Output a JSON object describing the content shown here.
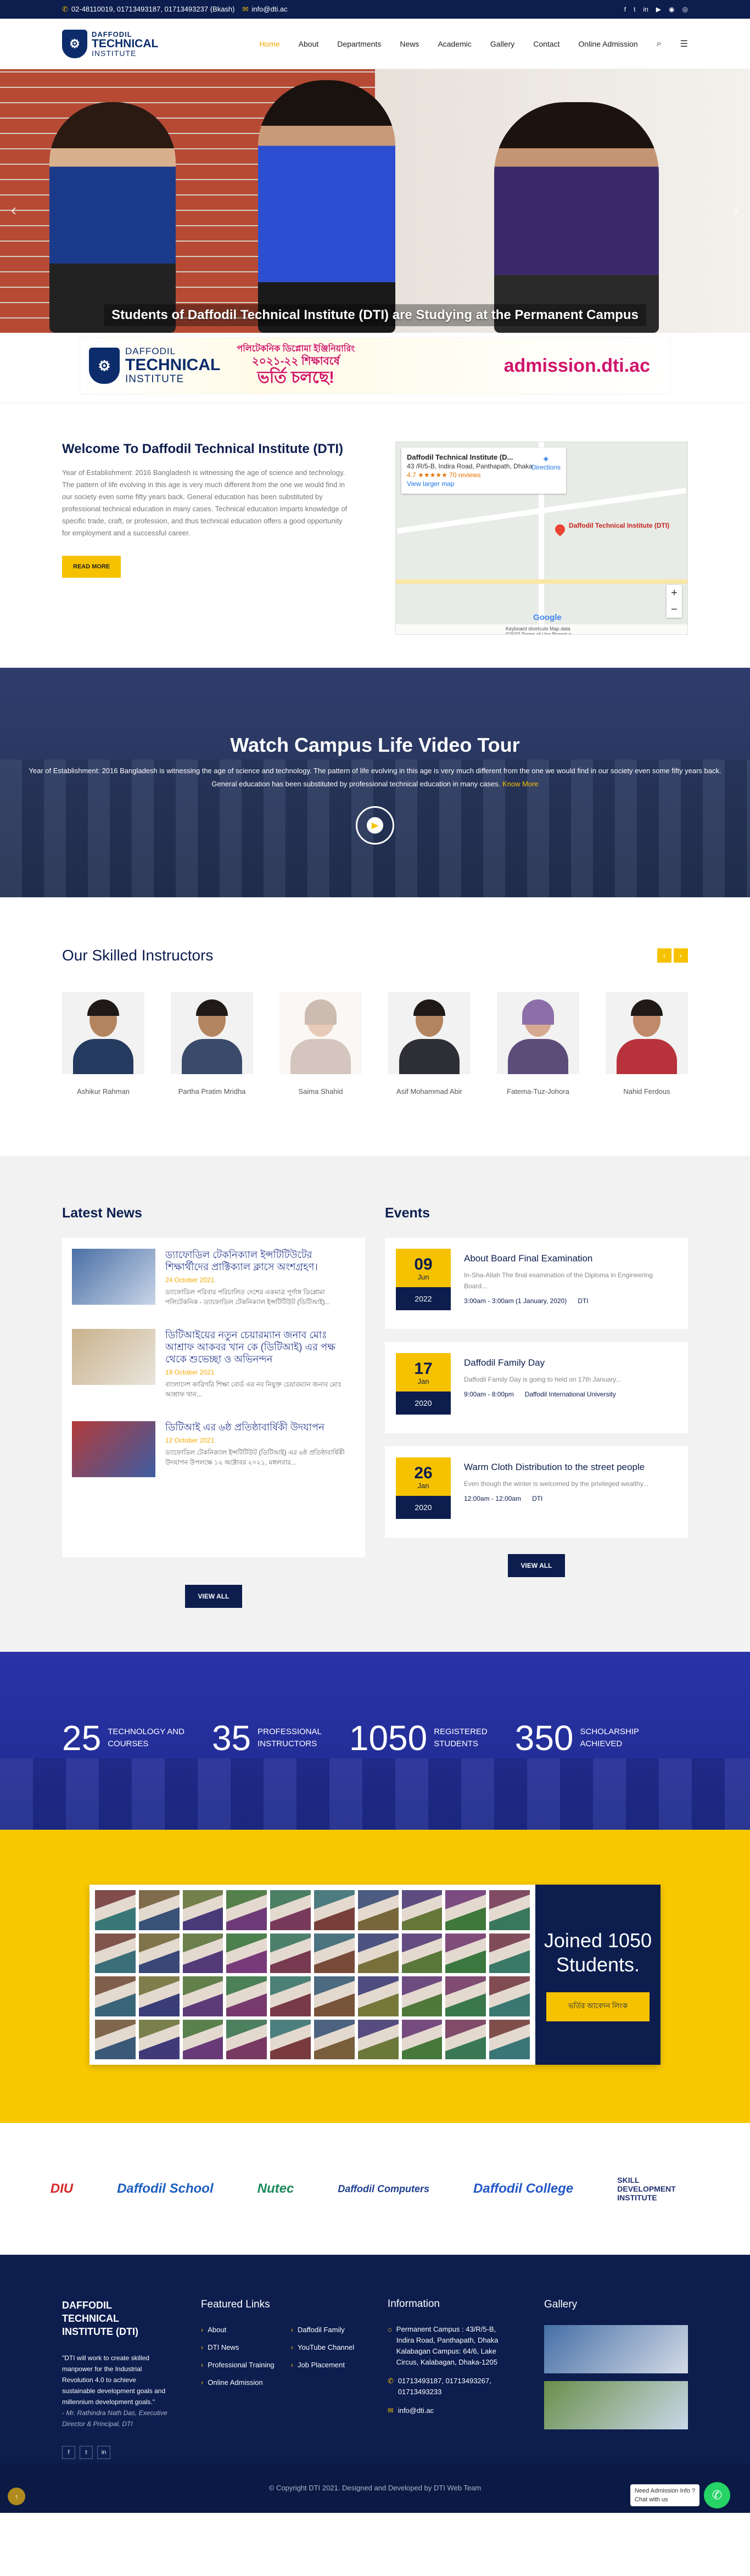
{
  "topbar": {
    "phone": "02-48110019, 01713493187, 01713493237 (Bkash)",
    "email": "info@dti.ac",
    "social": [
      "f",
      "t",
      "in",
      "▶",
      "◉",
      "◎"
    ]
  },
  "header": {
    "logo_l1": "DAFFODIL",
    "logo_l2": "TECHNICAL",
    "logo_l3": "INSTITUTE",
    "nav": [
      "Home",
      "About",
      "Departments",
      "News",
      "Academic",
      "Gallery",
      "Contact",
      "Online Admission"
    ]
  },
  "hero": {
    "caption": "Students of Daffodil Technical Institute (DTI) are Studying at the Permanent Campus"
  },
  "admission": {
    "l1": "পলিটেকনিক ডিপ্লোমা ইঞ্জিনিয়ারিং",
    "l2": "২০২১-২২ শিক্ষাবর্ষে",
    "l3": "ভর্তি চলছে!",
    "url": "admission.dti.ac"
  },
  "welcome": {
    "title": "Welcome To Daffodil Technical Institute (DTI)",
    "text": "Year of Establishment: 2016 Bangladesh is witnessing the age of science and technology. The pattern of life evolving in this age is very much different from the one we would find in our society even some fifty years back. General education has been substituted by professional technical education in many cases. Technical education imparts knowledge of specific trade, craft, or profession, and thus technical education offers a good opportunity for employment and a successful career.",
    "button": "READ MORE"
  },
  "map": {
    "place": "Daffodil Technical Institute (D...",
    "address": "43 /R/5-B, Indira Road, Panthapath, Dhaka",
    "rating": "4.7 ★★★★★  70 reviews",
    "larger": "View larger map",
    "directions": "Directions",
    "pin": "Daffodil Technical Institute (DTI)",
    "brand": "Google",
    "footer": "Keyboard shortcuts   Map data ©2022   Terms of Use   Report a map error"
  },
  "video": {
    "title": "Watch Campus Life Video Tour",
    "text": "Year of Establishment: 2016 Bangladesh is witnessing the age of science and technology. The pattern of life evolving in this age is very much different from the one we would find in our society even some fifty years back. General education has been substituted by professional technical education in many cases.",
    "tag": " Know More"
  },
  "instructors": {
    "title": "Our Skilled Instructors",
    "items": [
      {
        "name": "Ashikur Rahman"
      },
      {
        "name": "Partha Pratim Mridha"
      },
      {
        "name": "Saima Shahid"
      },
      {
        "name": "Asif Mohammad Abir"
      },
      {
        "name": "Fatema-Tuz-Johora"
      },
      {
        "name": "Nahid Ferdous"
      }
    ]
  },
  "news": {
    "title": "Latest News",
    "items": [
      {
        "title": "ড্যাফোডিল টেকনিক্যাল ইন্সটিটিউটের শিক্ষার্থীদের প্রাক্টিক্যাল ক্লাসে অংশগ্রহণ।",
        "date": "24 October 2021",
        "excerpt": "ড্যাফোডিল পরিবার পরিচালিত দেশের একমাত্র পূর্ণাঙ্গ ডিপ্লোমা পলিটেকনিক - ড্যাফোডিল টেকনিক্যাল ইন্সটিটিউট (ডিটিআই)..."
      },
      {
        "title": "ডিটিআইয়ের নতুন চেয়ারম্যান জনাব মোঃ আশ্রাফ আকবর খান কে (ডিটিআই) এর পক্ষ থেকে শুভেচ্ছা ও অভিনন্দন",
        "date": "19 October 2021",
        "excerpt": "বাংলাদেশ কারিগরি শিক্ষা বোর্ড এর নব নিযুক্ত চেয়ারম্যান জনাব মোঃ আশ্রাফ খান..."
      },
      {
        "title": "ডিটিআই এর ৬ষ্ঠ প্রতিষ্ঠাবার্ষিকী উদযাপন",
        "date": "12 October 2021",
        "excerpt": "ড্যাফোডিল টেকনিক্যাল ইন্সটিটিউট (ডিটিআই) এর ৬ষ্ঠ প্রতিষ্ঠাবার্ষিকী উদযাপন উপলক্ষে ১২ অক্টোবর ২০২১, মঙ্গলবার..."
      }
    ],
    "button": "VIEW ALL"
  },
  "events": {
    "title": "Events",
    "items": [
      {
        "day": "09",
        "month": "Jun",
        "year": "2022",
        "title": "About Board Final Examination",
        "excerpt": "In-Sha-Allah The final examination of the Diploma in Engineering Board...",
        "time": "3:00am - 3:00am (1 January, 2020)",
        "place": "DTI"
      },
      {
        "day": "17",
        "month": "Jan",
        "year": "2020",
        "title": "Daffodil Family Day",
        "excerpt": "Daffodil Family Day is going to held on 17th January...",
        "time": "9:00am - 8:00pm",
        "place": "Daffodil International University"
      },
      {
        "day": "26",
        "month": "Jan",
        "year": "2020",
        "title": "Warm Cloth Distribution to the street people",
        "excerpt": "Even though the winter is welcomed by the privileged wealthy...",
        "time": "12:00am - 12:00am",
        "place": "DTI"
      }
    ],
    "button": "VIEW ALL"
  },
  "counters": [
    {
      "num": "25",
      "l1": "TECHNOLOGY AND",
      "l2": "COURSES"
    },
    {
      "num": "35",
      "l1": "PROFESSIONAL",
      "l2": "INSTRUCTORS"
    },
    {
      "num": "1050",
      "l1": "REGISTERED",
      "l2": "STUDENTS"
    },
    {
      "num": "350",
      "l1": "SCHOLARSHIP",
      "l2": "ACHIEVED"
    }
  ],
  "joined": {
    "l1": "Joined 1050",
    "l2": "Students.",
    "button": "ভর্তির আবেদন লিংক"
  },
  "partners": [
    {
      "name": "DIU",
      "color": "#d72b2b"
    },
    {
      "name": "Daffodil School",
      "color": "#1f5fbf"
    },
    {
      "name": "Nutec",
      "color": "#1d8a5a"
    },
    {
      "name": "Daffodil Computers",
      "color": "#1f3f8f"
    },
    {
      "name": "Daffodil College",
      "color": "#2557c8"
    },
    {
      "name": "SKILL DEVELOPMENT INSTITUTE",
      "color": "#1f2f6f"
    }
  ],
  "footer": {
    "about_title": "DAFFODIL TECHNICAL INSTITUTE (DTI)",
    "quote": "\"DTI will work to create skilled manpower for the Industrial Revolution 4.0 to achieve sustainable development goals and millennium development goals.\"",
    "author": "- Mr. Rathindra Nath Das, Executive Director & Principal, DTI",
    "links_title": "Featured Links",
    "links1": [
      "About",
      "DTI News",
      "Professional Training",
      "Online Admission"
    ],
    "links2": [
      "Daffodil Family",
      "YouTube Channel",
      "Job Placement"
    ],
    "info_title": "Information",
    "campus": "Permanent Campus : 43/R/5-B, Indira Road, Panthapath, Dhaka",
    "campus2": "Kalabagan Campus: 64/6, Lake Circus, Kalabagan, Dhaka-1205",
    "phones": "01713493187, 01713493267, 01713493233",
    "email": "info@dti.ac",
    "gallery_title": "Gallery",
    "copyright": "© Copyright DTI 2021. Designed and Developed by DTI Web Team",
    "chat_l1": "Need Admission Info ?",
    "chat_l2": "Chat with us"
  }
}
